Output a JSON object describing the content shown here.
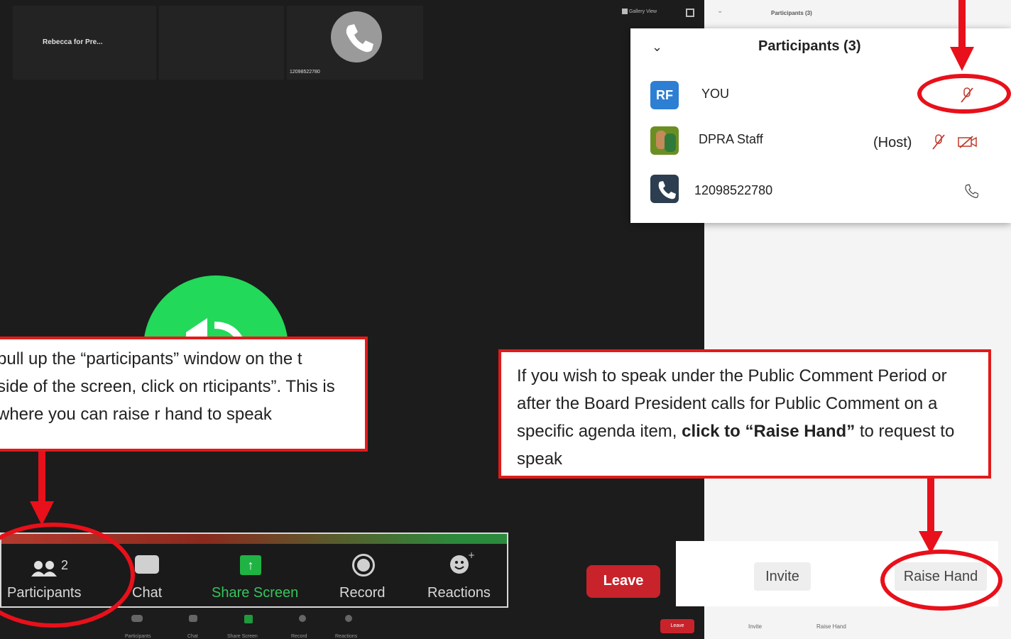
{
  "video": {
    "thumbnail_1_name": "Rebecca for Pre...",
    "thumbnail_3_name": "12098522780",
    "gallery_view_label": "Gallery View",
    "participants_small_label": "Participants (3)"
  },
  "participants_panel": {
    "title": "Participants (3)",
    "rows": [
      {
        "initials": "RF",
        "name": "YOU",
        "tag": ""
      },
      {
        "initials": "",
        "name": "DPRA Staff",
        "tag": "(Host)"
      },
      {
        "initials": "",
        "name": "12098522780",
        "tag": ""
      }
    ]
  },
  "callout_left": {
    "text": "pull up the “participants” window on the t side of the screen, click on rticipants”. This is where you can raise r hand to speak"
  },
  "callout_right": {
    "text_before": "If you wish to speak under the Public Comment Period or after the Board President calls for Public Comment on a specific agenda item, ",
    "text_bold": "click to “Raise Hand”",
    "text_after": " to request to speak"
  },
  "toolbar": {
    "participants_count": "2",
    "participants_label": "Participants",
    "chat_label": "Chat",
    "share_screen_label": "Share Screen",
    "record_label": "Record",
    "reactions_label": "Reactions"
  },
  "leavebar": {
    "leave_label": "Leave",
    "invite_label": "Invite",
    "raise_hand_label": "Raise Hand"
  },
  "tiny_toolbar": {
    "participants": "Participants",
    "chat": "Chat",
    "share_screen": "Share Screen",
    "record": "Record",
    "reactions": "Reactions",
    "leave": "Leave",
    "invite": "Invite",
    "raise_hand": "Raise Hand"
  },
  "colors": {
    "accent_red": "#e8101a",
    "zoom_green": "#23d959",
    "avatar_blue": "#2d7fd3",
    "leave_red": "#c8232b"
  }
}
